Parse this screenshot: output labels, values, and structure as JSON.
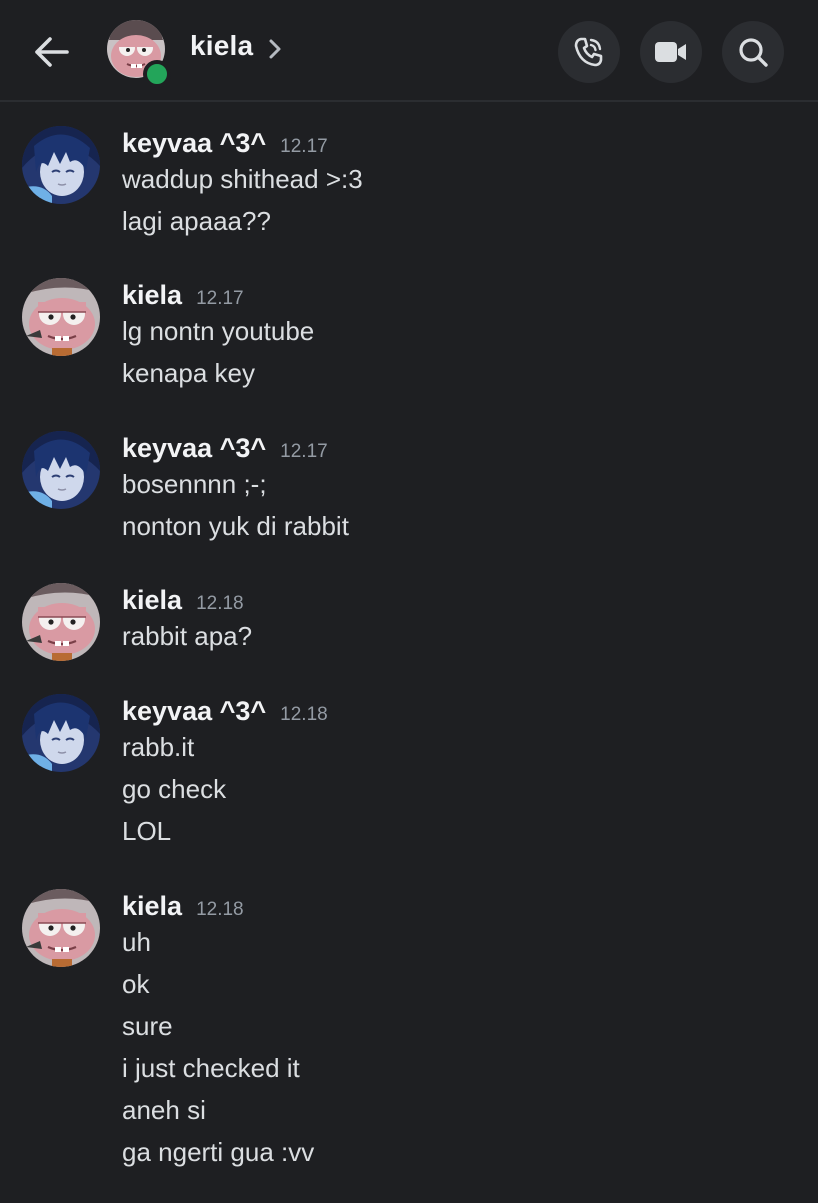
{
  "header": {
    "title": "kiela",
    "status_color": "#23a55a",
    "icons": [
      "back-arrow-icon",
      "chevron-right-icon",
      "voice-call-icon",
      "video-call-icon",
      "search-icon"
    ]
  },
  "users": {
    "keyvaa": {
      "name": "keyvaa ^3^",
      "avatar": "blue-haired-anime-avatar"
    },
    "kiela": {
      "name": "kiela",
      "avatar": "pink-cartoon-character-avatar"
    }
  },
  "messages": [
    {
      "user": "keyvaa",
      "author": "keyvaa ^3^",
      "time": "12.17",
      "lines": [
        "waddup shithead >:3",
        "lagi apaaa??"
      ]
    },
    {
      "user": "kiela",
      "author": "kiela",
      "time": "12.17",
      "lines": [
        "lg nontn youtube",
        "kenapa key"
      ]
    },
    {
      "user": "keyvaa",
      "author": "keyvaa ^3^",
      "time": "12.17",
      "lines": [
        "bosennnn ;-;",
        "nonton yuk di rabbit"
      ]
    },
    {
      "user": "kiela",
      "author": "kiela",
      "time": "12.18",
      "lines": [
        "rabbit apa?"
      ]
    },
    {
      "user": "keyvaa",
      "author": "keyvaa ^3^",
      "time": "12.18",
      "lines": [
        "rabb.it",
        "go check",
        "LOL"
      ]
    },
    {
      "user": "kiela",
      "author": "kiela",
      "time": "12.18",
      "lines": [
        "uh",
        "ok",
        "sure",
        "i just checked it",
        "aneh si",
        "ga ngerti gua :vv"
      ]
    }
  ]
}
